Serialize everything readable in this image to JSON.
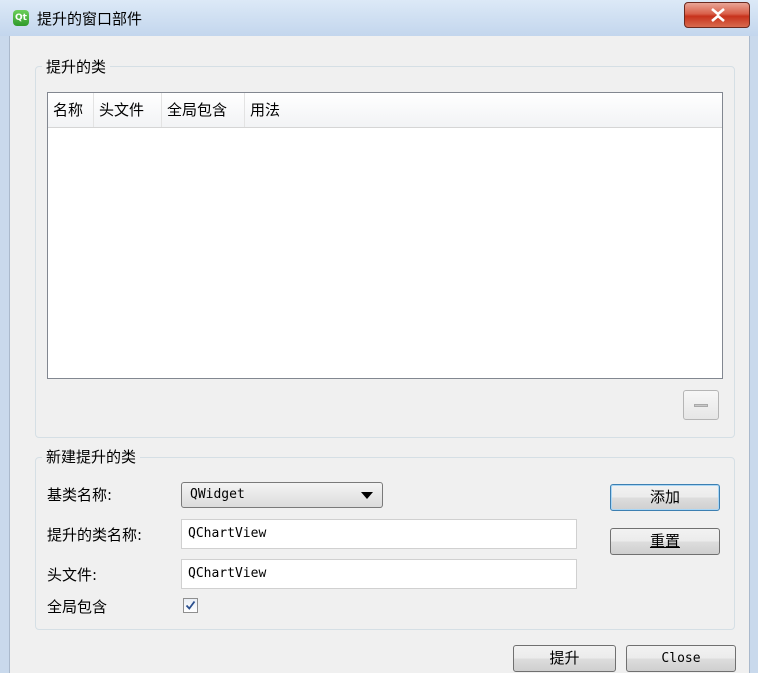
{
  "window": {
    "title": "提升的窗口部件",
    "icon_text": "Qt"
  },
  "promoted_classes": {
    "group_title": "提升的类",
    "columns": [
      "名称",
      "头文件",
      "全局包含",
      "用法"
    ],
    "rows": []
  },
  "new_promoted": {
    "group_title": "新建提升的类",
    "base_class_label": "基类名称:",
    "base_class_value": "QWidget",
    "class_name_label": "提升的类名称:",
    "class_name_value": "QChartView",
    "header_label": "头文件:",
    "header_value": "QChartView",
    "global_include_label": "全局包含",
    "global_include_checked": true
  },
  "buttons": {
    "add": "添加",
    "reset": "重置",
    "promote": "提升",
    "close": "Close"
  }
}
